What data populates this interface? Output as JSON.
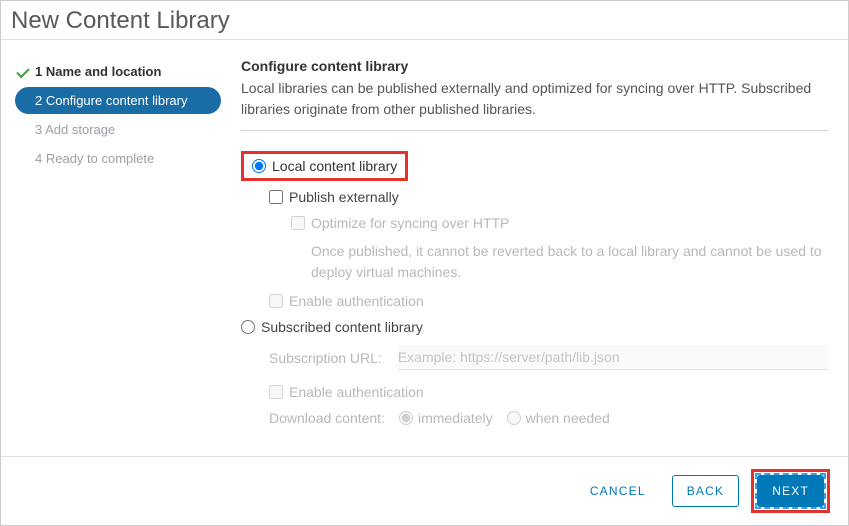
{
  "title": "New Content Library",
  "steps": [
    {
      "label": "1 Name and location"
    },
    {
      "label": "2 Configure content library"
    },
    {
      "label": "3 Add storage"
    },
    {
      "label": "4 Ready to complete"
    }
  ],
  "section": {
    "heading": "Configure content library",
    "description": "Local libraries can be published externally and optimized for syncing over HTTP. Subscribed libraries originate from other published libraries."
  },
  "options": {
    "local_label": "Local content library",
    "publish_label": "Publish externally",
    "optimize_label": "Optimize for syncing over HTTP",
    "optimize_desc": "Once published, it cannot be reverted back to a local library and cannot be used to deploy virtual machines.",
    "enable_auth_label": "Enable authentication",
    "subscribed_label": "Subscribed content library",
    "subscription_url_label": "Subscription URL:",
    "subscription_url_placeholder": "Example: https://server/path/lib.json",
    "enable_auth_label2": "Enable authentication",
    "download_label": "Download content:",
    "download_immediately": "immediately",
    "download_when_needed": "when needed"
  },
  "buttons": {
    "cancel": "CANCEL",
    "back": "BACK",
    "next": "NEXT"
  }
}
